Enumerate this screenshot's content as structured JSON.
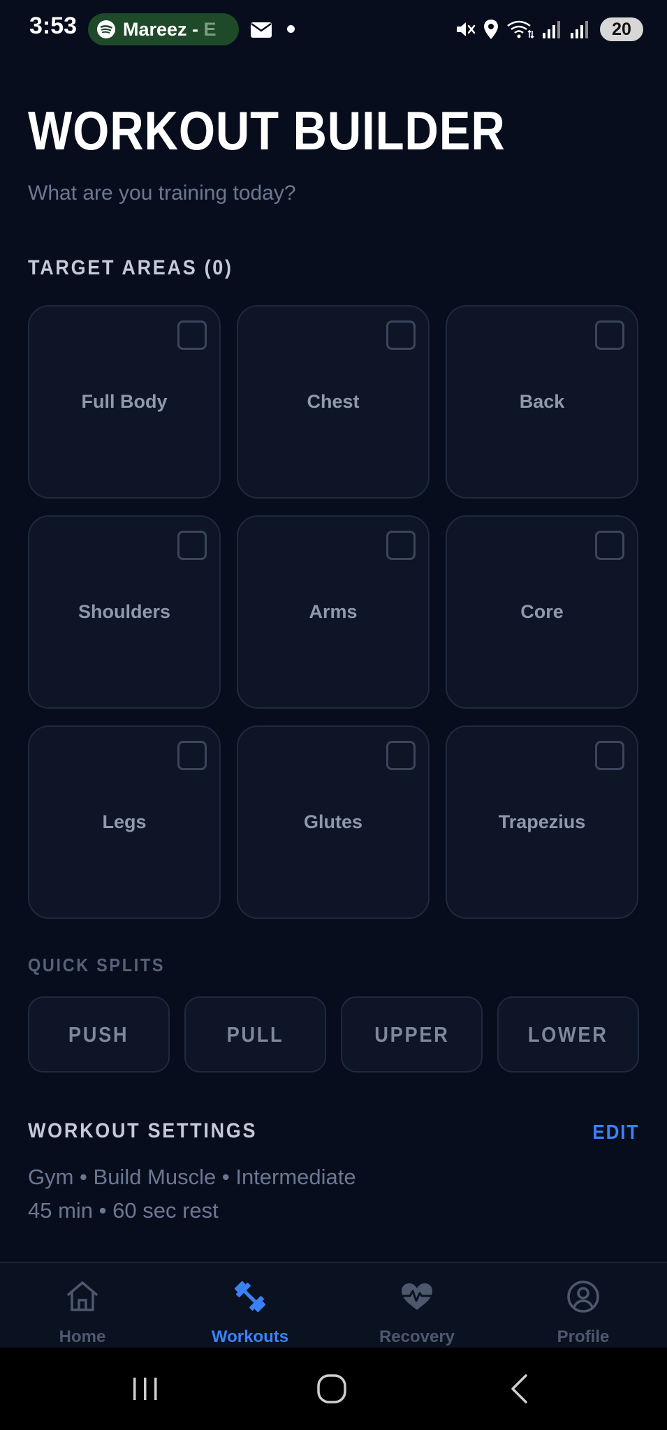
{
  "status_bar": {
    "time": "3:53",
    "media_title": "Mareez - ",
    "media_title_fade": "E",
    "battery_level": "20"
  },
  "header": {
    "title": "WORKOUT BUILDER",
    "subtitle": "What are you training today?"
  },
  "target_areas": {
    "heading": "TARGET AREAS (0)",
    "items": [
      {
        "label": "Full Body",
        "checked": false
      },
      {
        "label": "Chest",
        "checked": false
      },
      {
        "label": "Back",
        "checked": false
      },
      {
        "label": "Shoulders",
        "checked": false
      },
      {
        "label": "Arms",
        "checked": false
      },
      {
        "label": "Core",
        "checked": false
      },
      {
        "label": "Legs",
        "checked": false
      },
      {
        "label": "Glutes",
        "checked": false
      },
      {
        "label": "Trapezius",
        "checked": false
      }
    ]
  },
  "quick_splits": {
    "heading": "QUICK SPLITS",
    "items": [
      "PUSH",
      "PULL",
      "UPPER",
      "LOWER"
    ]
  },
  "workout_settings": {
    "heading": "WORKOUT SETTINGS",
    "edit_label": "EDIT",
    "line1": "Gym • Build Muscle • Intermediate",
    "line2": "45 min • 60 sec rest"
  },
  "bottom_nav": {
    "items": [
      {
        "label": "Home",
        "icon": "home-icon",
        "active": false
      },
      {
        "label": "Workouts",
        "icon": "dumbbell-icon",
        "active": true
      },
      {
        "label": "Recovery",
        "icon": "heart-pulse-icon",
        "active": false
      },
      {
        "label": "Profile",
        "icon": "user-circle-icon",
        "active": false
      }
    ]
  },
  "colors": {
    "background": "#070d1c",
    "card": "#0d1526",
    "card_border": "#1f2a3f",
    "accent": "#3b82f6",
    "muted_text": "#6c7892"
  }
}
